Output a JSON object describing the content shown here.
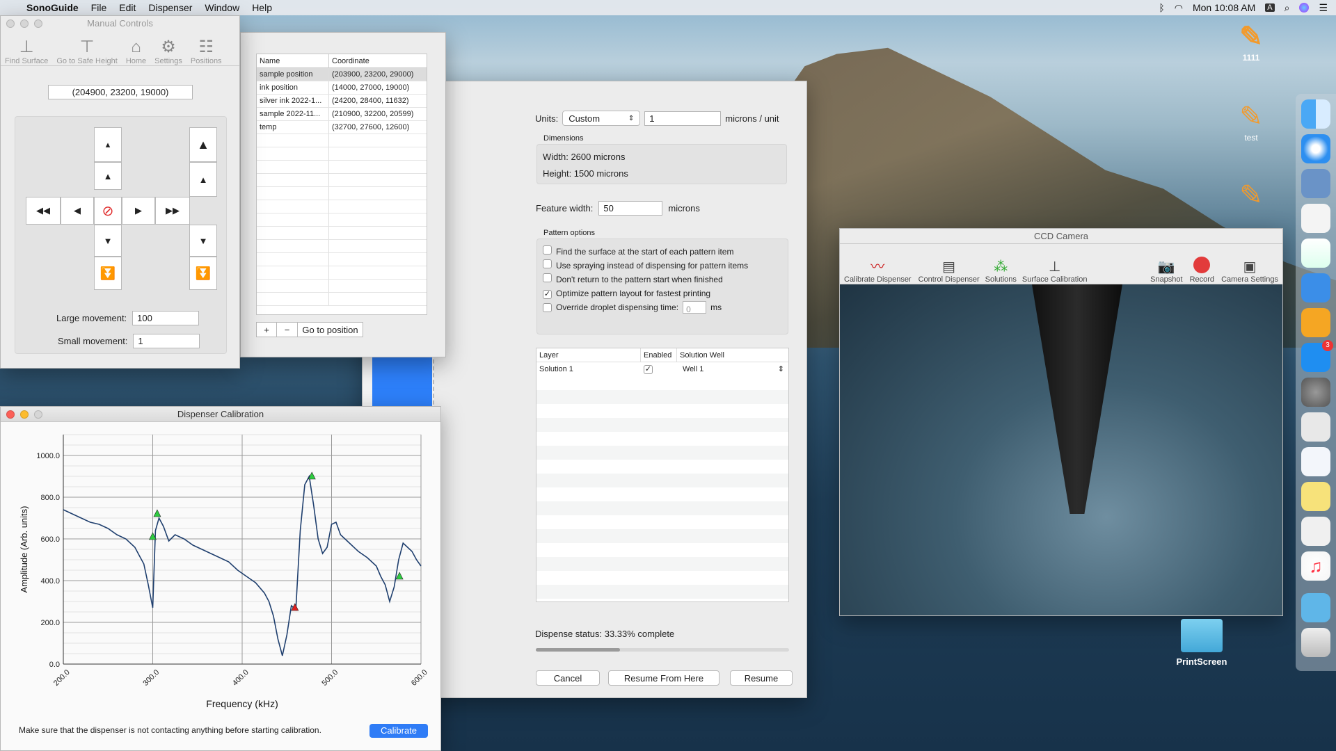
{
  "menubar": {
    "app": "SonoGuide",
    "items": [
      "File",
      "Edit",
      "Dispenser",
      "Window",
      "Help"
    ],
    "clock": "Mon 10:08 AM",
    "input_source": "A"
  },
  "manual_controls": {
    "title": "Manual Controls",
    "toolbar": [
      "Find Surface",
      "Go to Safe Height",
      "Home",
      "Settings",
      "Positions"
    ],
    "position": "(204900, 23200, 19000)",
    "large_label": "Large movement:",
    "large_value": "100",
    "small_label": "Small movement:",
    "small_value": "1"
  },
  "positions": {
    "col_name": "Name",
    "col_coord": "Coordinate",
    "rows": [
      {
        "name": "sample position",
        "coord": "(203900, 23200, 29000)"
      },
      {
        "name": "ink position",
        "coord": "(14000, 27000, 19000)"
      },
      {
        "name": "silver ink 2022-1...",
        "coord": "(24200, 28400, 11632)"
      },
      {
        "name": "sample 2022-11...",
        "coord": "(210900, 32200, 20599)"
      },
      {
        "name": "temp",
        "coord": "(32700, 27600, 12600)"
      }
    ],
    "add": "+",
    "remove": "−",
    "goto": "Go to position"
  },
  "pattern": {
    "units_label": "Units:",
    "units_value": "Custom",
    "units_number": "1",
    "units_suffix": "microns / unit",
    "dimensions_title": "Dimensions",
    "width": "Width: 2600 microns",
    "height": "Height: 1500 microns",
    "feature_label": "Feature width:",
    "feature_value": "50",
    "feature_unit": "microns",
    "options_title": "Pattern options",
    "options": [
      {
        "label": "Find the surface at the start of each pattern item",
        "checked": false
      },
      {
        "label": "Use spraying instead of dispensing for pattern items",
        "checked": false
      },
      {
        "label": "Don't return to the pattern start when finished",
        "checked": false
      },
      {
        "label": "Optimize pattern layout for fastest printing",
        "checked": true
      },
      {
        "label": "Override droplet dispensing time:",
        "checked": false
      }
    ],
    "droplet_time": "0",
    "droplet_unit": "ms",
    "layer_cols": [
      "Layer",
      "Enabled",
      "Solution Well"
    ],
    "layers": [
      {
        "layer": "Solution 1",
        "enabled": "✓",
        "well": "Well 1"
      }
    ],
    "status": "Dispense status: 33.33% complete",
    "progress": 0.3333,
    "cancel": "Cancel",
    "resume_here": "Resume From Here",
    "resume": "Resume"
  },
  "ccd": {
    "title": "CCD Camera",
    "tools": [
      "Calibrate Dispenser",
      "Control Dispenser",
      "Solutions",
      "Surface Calibration",
      "Snapshot",
      "Record",
      "Camera Settings"
    ]
  },
  "calibration": {
    "title": "Dispenser Calibration",
    "note": "Make sure that the dispenser is not contacting anything before starting calibration.",
    "button": "Calibrate"
  },
  "chart_data": {
    "type": "line",
    "xlabel": "Frequency (kHz)",
    "ylabel": "Amplitude (Arb. units)",
    "xlim": [
      200,
      600
    ],
    "ylim": [
      0,
      1100
    ],
    "xticks": [
      "200.0",
      "300.0",
      "400.0",
      "500.0",
      "600.0"
    ],
    "yticks": [
      "0.0",
      "200.0",
      "400.0",
      "600.0",
      "800.0",
      "1000.0"
    ],
    "grid": true,
    "x": [
      200,
      210,
      220,
      230,
      240,
      250,
      260,
      270,
      280,
      285,
      290,
      295,
      300,
      303,
      307,
      312,
      318,
      325,
      335,
      345,
      355,
      365,
      375,
      385,
      395,
      405,
      415,
      425,
      430,
      435,
      440,
      445,
      450,
      455,
      460,
      465,
      470,
      475,
      480,
      485,
      490,
      495,
      500,
      505,
      510,
      520,
      530,
      540,
      550,
      555,
      560,
      565,
      570,
      575,
      580,
      585,
      590,
      595,
      600
    ],
    "y": [
      740,
      720,
      700,
      680,
      670,
      650,
      620,
      600,
      560,
      520,
      480,
      380,
      270,
      640,
      700,
      660,
      590,
      620,
      600,
      570,
      550,
      530,
      510,
      490,
      450,
      420,
      390,
      340,
      300,
      230,
      120,
      40,
      140,
      280,
      260,
      640,
      860,
      900,
      760,
      600,
      530,
      560,
      670,
      680,
      620,
      580,
      540,
      510,
      470,
      420,
      380,
      300,
      370,
      500,
      580,
      560,
      540,
      500,
      470
    ],
    "markers": [
      {
        "x": 300,
        "y": 610,
        "color": "#2ecc40"
      },
      {
        "x": 305,
        "y": 720,
        "color": "#2ecc40"
      },
      {
        "x": 478,
        "y": 900,
        "color": "#2ecc40"
      },
      {
        "x": 459,
        "y": 270,
        "color": "#e02020"
      },
      {
        "x": 576,
        "y": 420,
        "color": "#2ecc40"
      }
    ]
  },
  "desktop": {
    "icons": [
      "1111",
      "test"
    ],
    "folder": "PrintScreen"
  },
  "colors": {
    "accent": "#2f7cf6",
    "blue_panel": "#2d7ff9",
    "line": "#1f3f6e"
  },
  "dock": {
    "badge": "3"
  }
}
